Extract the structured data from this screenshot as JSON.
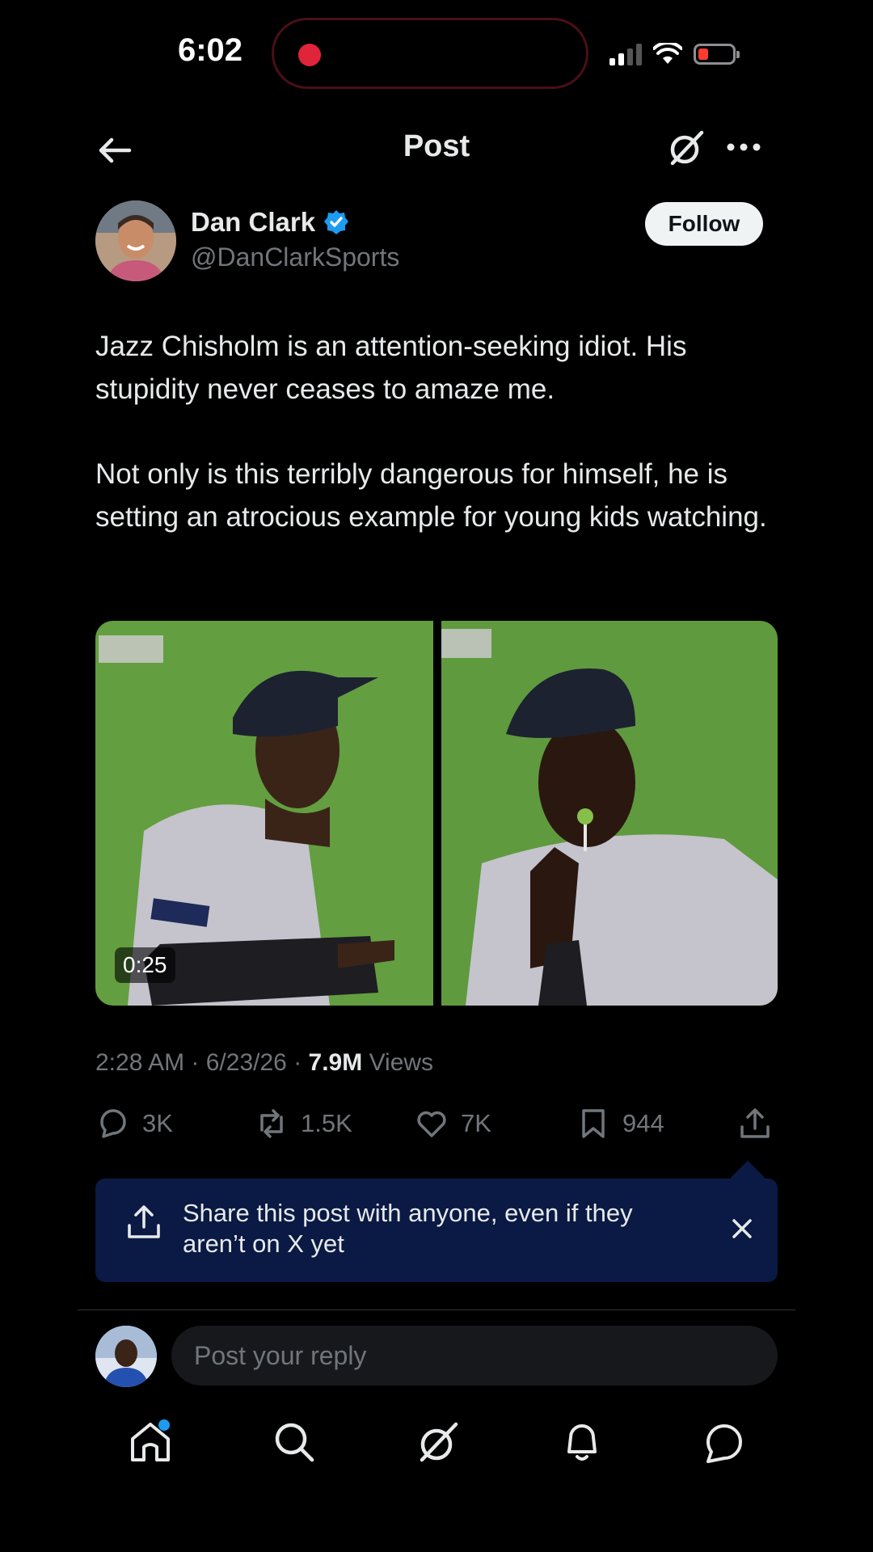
{
  "status_bar": {
    "time": "6:02"
  },
  "header": {
    "title": "Post"
  },
  "author": {
    "name": "Dan Clark",
    "handle": "@DanClarkSports",
    "follow_label": "Follow"
  },
  "post": {
    "paragraphs": [
      "Jazz Chisholm is an attention-seeking idiot. His stupidity never ceases to amaze me.",
      "Not only is this terribly dangerous for himself, he is setting an atrocious example for young kids watching."
    ],
    "media": {
      "video_duration": "0:25"
    },
    "time": "2:28 AM",
    "date": "6/23/26",
    "views_count": "7.9M",
    "views_label": "Views",
    "stats": {
      "replies": "3K",
      "reposts": "1.5K",
      "likes": "7K",
      "bookmarks": "944"
    }
  },
  "share_banner": {
    "text": "Share this post with anyone, even if they aren’t on X yet"
  },
  "reply": {
    "placeholder": "Post your reply"
  },
  "icons": {
    "back": "arrow-left-icon",
    "grok": "grok-icon",
    "more": "more-horizontal-icon",
    "verified": "verified-badge-icon",
    "reply": "speech-bubble-icon",
    "repost": "repost-icon",
    "like": "heart-icon",
    "bookmark": "bookmark-icon",
    "share": "share-upload-icon",
    "close": "close-icon",
    "home": "home-icon",
    "search": "search-icon",
    "notifications": "bell-icon",
    "messages": "message-icon"
  },
  "colors": {
    "background": "#000000",
    "text": "#e7e9ea",
    "secondary_text": "#71767b",
    "accent": "#1d9bf0",
    "banner": "#0a1a44",
    "recording": "#e0243a"
  }
}
